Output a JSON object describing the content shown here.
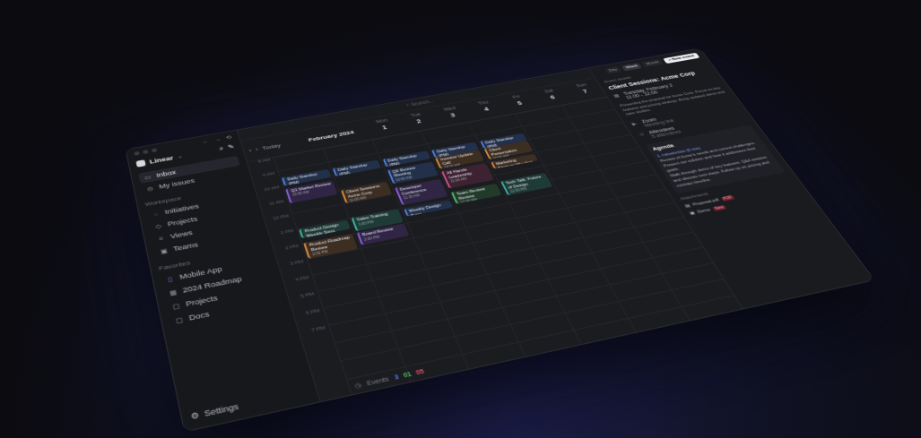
{
  "sidebar": {
    "workspace": "Linear",
    "items": [
      {
        "label": "Inbox",
        "icon": "inbox-icon",
        "active": true
      },
      {
        "label": "My issues",
        "icon": "issues-icon",
        "active": false
      }
    ],
    "workspace_section": "Workspace",
    "workspace_items": [
      {
        "label": "Initiatives",
        "icon": "target-icon"
      },
      {
        "label": "Projects",
        "icon": "cube-icon"
      },
      {
        "label": "Views",
        "icon": "layers-icon"
      },
      {
        "label": "Teams",
        "icon": "team-icon"
      }
    ],
    "favorites_section": "Favorites",
    "favorite_items": [
      {
        "label": "Mobile App",
        "icon": "file-icon"
      },
      {
        "label": "2024 Roadmap",
        "icon": "calendar-icon"
      },
      {
        "label": "Projects",
        "icon": "folder-icon"
      },
      {
        "label": "Docs",
        "icon": "folder-icon"
      }
    ],
    "settings_label": "Settings"
  },
  "calendar": {
    "search_placeholder": "Search...",
    "today_label": "Today",
    "month": "February 2024",
    "days": [
      {
        "name": "Mon",
        "num": "1"
      },
      {
        "name": "Tue",
        "num": "2"
      },
      {
        "name": "Wed",
        "num": "3"
      },
      {
        "name": "Thu",
        "num": "4"
      },
      {
        "name": "Fri",
        "num": "5"
      },
      {
        "name": "Sat",
        "num": "6"
      },
      {
        "name": "Sun",
        "num": "7"
      }
    ],
    "times": [
      "8 AM",
      "9 AM",
      "10 AM",
      "11 AM",
      "12 PM",
      "1 PM",
      "2 PM",
      "3 PM",
      "4 PM",
      "5 PM",
      "6 PM",
      "7 PM"
    ],
    "events": [
      {
        "title": "Daily Standup (PM)",
        "time": "9:00 AM",
        "color": "blue",
        "col": 0,
        "row": 1.5,
        "h": 0.6
      },
      {
        "title": "Daily Standup (PM)",
        "time": "9:00 AM",
        "color": "blue",
        "col": 1,
        "row": 1.5,
        "h": 0.6
      },
      {
        "title": "Daily Standup (PM)",
        "time": "9:00 AM",
        "color": "blue",
        "col": 2,
        "row": 1.5,
        "h": 0.6
      },
      {
        "title": "Daily Standup (PM)",
        "time": "9:00 AM",
        "color": "blue",
        "col": 3,
        "row": 1.5,
        "h": 0.6
      },
      {
        "title": "Daily Standup (PM)",
        "time": "9:00 AM",
        "color": "blue",
        "col": 4,
        "row": 1.5,
        "h": 0.6
      },
      {
        "title": "Q1 Market Review",
        "time": "10:00 AM",
        "color": "purple",
        "col": 0,
        "row": 2.3,
        "h": 1.0
      },
      {
        "title": "Q4 Review Meeting",
        "time": "10:00 AM",
        "color": "blue",
        "col": 2,
        "row": 2.3,
        "h": 1.0
      },
      {
        "title": "Investor Update Call",
        "time": "10:00 AM",
        "color": "orange",
        "col": 3,
        "row": 2.1,
        "h": 0.8
      },
      {
        "title": "Client Presentation",
        "time": "10:00 AM",
        "color": "orange",
        "col": 4,
        "row": 2.1,
        "h": 0.8
      },
      {
        "title": "Client Sessions: Acme Corp",
        "time": "11:00 AM",
        "color": "orange",
        "col": 1,
        "row": 3.1,
        "h": 0.9
      },
      {
        "title": "Developer Conference",
        "time": "11:30 AM",
        "color": "purple",
        "col": 2,
        "row": 3.6,
        "h": 1.2
      },
      {
        "title": "All Hands Leadership",
        "time": "11:00 AM",
        "color": "pink",
        "col": 3,
        "row": 3.1,
        "h": 1.2
      },
      {
        "title": "Marketing Strategy Meeting",
        "time": "11:00 AM",
        "color": "orange",
        "col": 4,
        "row": 3.1,
        "h": 0.5
      },
      {
        "title": "Product Design Weekly Sync",
        "time": "1:00 PM",
        "color": "teal",
        "col": 0,
        "row": 5.1,
        "h": 0.6
      },
      {
        "title": "Sales Training",
        "time": "1:00 PM",
        "color": "teal",
        "col": 1,
        "row": 5.0,
        "h": 0.9
      },
      {
        "title": "Weekly Design Sync",
        "time": "1:00 PM",
        "color": "blue",
        "col": 2,
        "row": 5.1,
        "h": 0.5
      },
      {
        "title": "Team Review Review",
        "time": "12:30 PM",
        "color": "green",
        "col": 3,
        "row": 4.6,
        "h": 0.8
      },
      {
        "title": "Tech Talk: Future of Design",
        "time": "12:30 PM",
        "color": "teal",
        "col": 4,
        "row": 4.5,
        "h": 1.0
      },
      {
        "title": "Product Roadmap Review",
        "time": "2:00 PM",
        "color": "orange",
        "col": 0,
        "row": 6.0,
        "h": 1.0
      },
      {
        "title": "Board Review",
        "time": "2:00 PM",
        "color": "purple",
        "col": 1,
        "row": 6.0,
        "h": 0.8
      }
    ],
    "footer_label": "Events",
    "footer_counts": [
      "3",
      "01",
      "05"
    ]
  },
  "panel": {
    "view_options": [
      "Day",
      "Week",
      "Month"
    ],
    "new_event_label": "+ New event",
    "event_details_label": "Event details",
    "event_title": "Client Sessions: Acme Corp",
    "date_line": "Tuesday, February 2",
    "time_line": "11:00 - 12:00",
    "description": "Presenting the proposal for Acme Corp. Focus on key features and pricing strategy. Bring updated demo and case studies.",
    "location": "Zoom",
    "location_sub": "Meeting link",
    "attendees_label": "Attendees",
    "attendees": "5 attendees",
    "agenda_title": "Agenda",
    "agenda_lines": [
      "1. Introduction (5 min)",
      "Review of Acme's needs and current challenges. Present our solution and how it addresses their goals.",
      "Walk through demo of key features: Q&A session and discuss next steps. Follow up on pricing and contract timeline."
    ],
    "attachment_section": "Attachments",
    "attachments": [
      {
        "name": "Proposal.pdf",
        "badge": "PDF",
        "sub": "Acme Corp proposal"
      },
      {
        "name": "Demo",
        "badge": "New",
        "sub": "Product demo recording"
      }
    ]
  },
  "colors": {
    "blue": "#4f7fdc",
    "teal": "#3bb39a",
    "orange": "#d68a3c",
    "purple": "#8a5ed6",
    "pink": "#d4508e",
    "green": "#4fbf6c"
  }
}
